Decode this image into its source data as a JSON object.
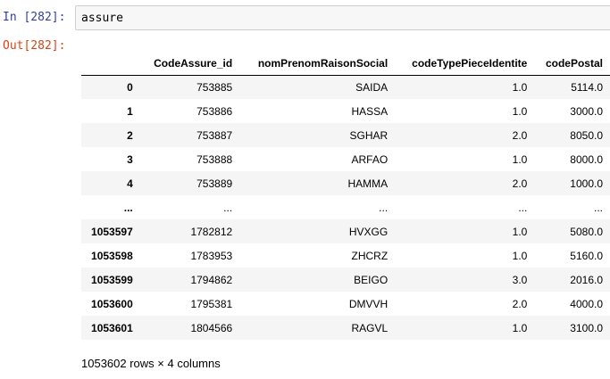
{
  "cell": {
    "in_prompt": "In [282]:",
    "out_prompt": "Out[282]:",
    "code": "assure"
  },
  "table": {
    "columns": [
      "CodeAssure_id",
      "nomPrenomRaisonSocial",
      "codeTypePieceIdentite",
      "codePostal"
    ],
    "rows": [
      {
        "index": "0",
        "values": [
          "753885",
          "SAIDA",
          "1.0",
          "5114.0"
        ]
      },
      {
        "index": "1",
        "values": [
          "753886",
          "HASSA",
          "1.0",
          "3000.0"
        ]
      },
      {
        "index": "2",
        "values": [
          "753887",
          "SGHAR",
          "2.0",
          "8050.0"
        ]
      },
      {
        "index": "3",
        "values": [
          "753888",
          "ARFAO",
          "1.0",
          "8000.0"
        ]
      },
      {
        "index": "4",
        "values": [
          "753889",
          "HAMMA",
          "2.0",
          "1000.0"
        ]
      },
      {
        "index": "...",
        "values": [
          "...",
          "...",
          "...",
          "..."
        ]
      },
      {
        "index": "1053597",
        "values": [
          "1782812",
          "HVXGG",
          "1.0",
          "5080.0"
        ]
      },
      {
        "index": "1053598",
        "values": [
          "1783953",
          "ZHCRZ",
          "1.0",
          "5160.0"
        ]
      },
      {
        "index": "1053599",
        "values": [
          "1794862",
          "BEIGO",
          "3.0",
          "2016.0"
        ]
      },
      {
        "index": "1053600",
        "values": [
          "1795381",
          "DMVVH",
          "2.0",
          "4000.0"
        ]
      },
      {
        "index": "1053601",
        "values": [
          "1804566",
          "RAGVL",
          "1.0",
          "3100.0"
        ]
      }
    ],
    "footer": "1053602 rows × 4 columns"
  }
}
